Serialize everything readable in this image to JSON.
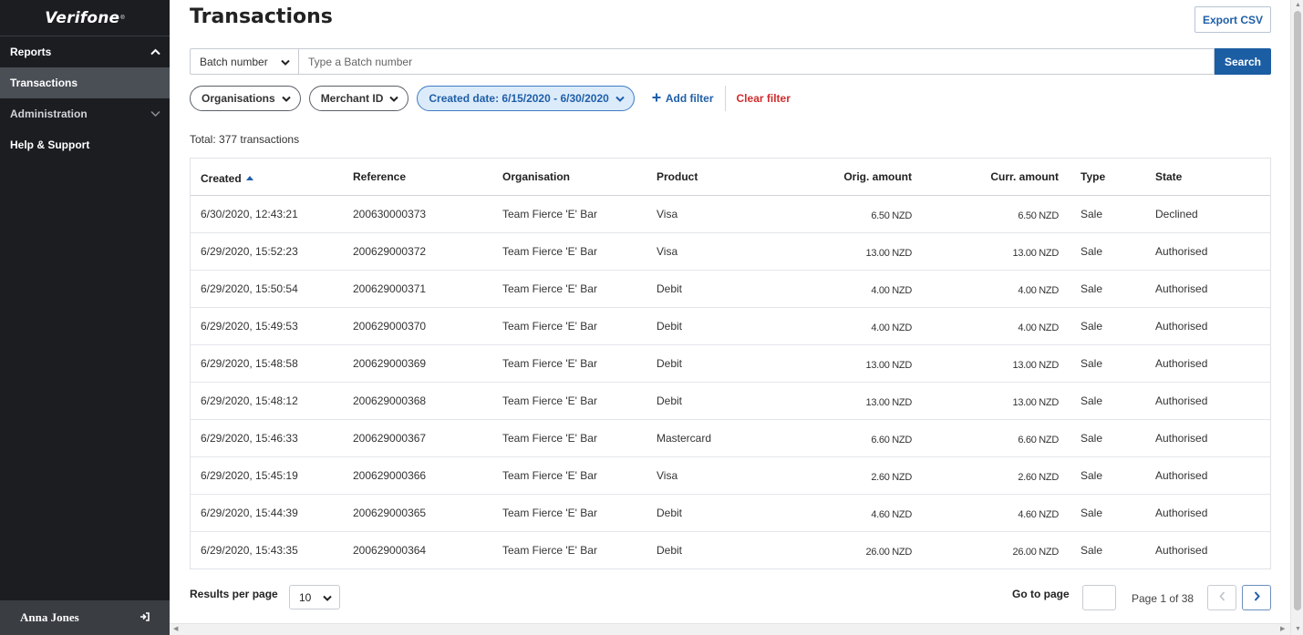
{
  "sidebar": {
    "brand": "Verifone",
    "brand_mark": "®",
    "items": [
      {
        "label": "Reports"
      },
      {
        "label": "Transactions"
      },
      {
        "label": "Administration"
      },
      {
        "label": "Help & Support"
      }
    ],
    "user": {
      "name": "Anna Jones"
    }
  },
  "header": {
    "title": "Transactions",
    "export_label": "Export CSV"
  },
  "search": {
    "field_select": "Batch number",
    "placeholder": "Type a Batch number",
    "value": "",
    "button_label": "Search"
  },
  "filters": {
    "pills": [
      {
        "label": "Organisations"
      },
      {
        "label": "Merchant ID"
      },
      {
        "label": "Created date: 6/15/2020 - 6/30/2020"
      }
    ],
    "add_label": "Add filter",
    "clear_label": "Clear filter"
  },
  "summary": {
    "total_text": "Total: 377 transactions"
  },
  "table": {
    "columns": [
      "Created",
      "Reference",
      "Organisation",
      "Product",
      "Orig. amount",
      "Curr. amount",
      "Type",
      "State"
    ],
    "rows": [
      {
        "created": "6/30/2020, 12:43:21",
        "reference": "200630000373",
        "organisation": "Team Fierce 'E' Bar",
        "product": "Visa",
        "orig": "6.50 NZD",
        "curr": "6.50 NZD",
        "type": "Sale",
        "state": "Declined"
      },
      {
        "created": "6/29/2020, 15:52:23",
        "reference": "200629000372",
        "organisation": "Team Fierce 'E' Bar",
        "product": "Visa",
        "orig": "13.00 NZD",
        "curr": "13.00 NZD",
        "type": "Sale",
        "state": "Authorised"
      },
      {
        "created": "6/29/2020, 15:50:54",
        "reference": "200629000371",
        "organisation": "Team Fierce 'E' Bar",
        "product": "Debit",
        "orig": "4.00 NZD",
        "curr": "4.00 NZD",
        "type": "Sale",
        "state": "Authorised"
      },
      {
        "created": "6/29/2020, 15:49:53",
        "reference": "200629000370",
        "organisation": "Team Fierce 'E' Bar",
        "product": "Debit",
        "orig": "4.00 NZD",
        "curr": "4.00 NZD",
        "type": "Sale",
        "state": "Authorised"
      },
      {
        "created": "6/29/2020, 15:48:58",
        "reference": "200629000369",
        "organisation": "Team Fierce 'E' Bar",
        "product": "Debit",
        "orig": "13.00 NZD",
        "curr": "13.00 NZD",
        "type": "Sale",
        "state": "Authorised"
      },
      {
        "created": "6/29/2020, 15:48:12",
        "reference": "200629000368",
        "organisation": "Team Fierce 'E' Bar",
        "product": "Debit",
        "orig": "13.00 NZD",
        "curr": "13.00 NZD",
        "type": "Sale",
        "state": "Authorised"
      },
      {
        "created": "6/29/2020, 15:46:33",
        "reference": "200629000367",
        "organisation": "Team Fierce 'E' Bar",
        "product": "Mastercard",
        "orig": "6.60 NZD",
        "curr": "6.60 NZD",
        "type": "Sale",
        "state": "Authorised"
      },
      {
        "created": "6/29/2020, 15:45:19",
        "reference": "200629000366",
        "organisation": "Team Fierce 'E' Bar",
        "product": "Visa",
        "orig": "2.60 NZD",
        "curr": "2.60 NZD",
        "type": "Sale",
        "state": "Authorised"
      },
      {
        "created": "6/29/2020, 15:44:39",
        "reference": "200629000365",
        "organisation": "Team Fierce 'E' Bar",
        "product": "Debit",
        "orig": "4.60 NZD",
        "curr": "4.60 NZD",
        "type": "Sale",
        "state": "Authorised"
      },
      {
        "created": "6/29/2020, 15:43:35",
        "reference": "200629000364",
        "organisation": "Team Fierce 'E' Bar",
        "product": "Debit",
        "orig": "26.00 NZD",
        "curr": "26.00 NZD",
        "type": "Sale",
        "state": "Authorised"
      }
    ]
  },
  "pagination": {
    "rpp_label": "Results per page",
    "rpp_value": "10",
    "goto_label": "Go to page",
    "goto_value": "",
    "page_info": "Page 1 of 38"
  },
  "colors": {
    "sidebar_bg": "#1b1d21",
    "active_item_bg": "#4a4e55",
    "primary": "#1c5ea3",
    "danger": "#d12d2d",
    "active_pill_bg": "#dcebfa"
  }
}
